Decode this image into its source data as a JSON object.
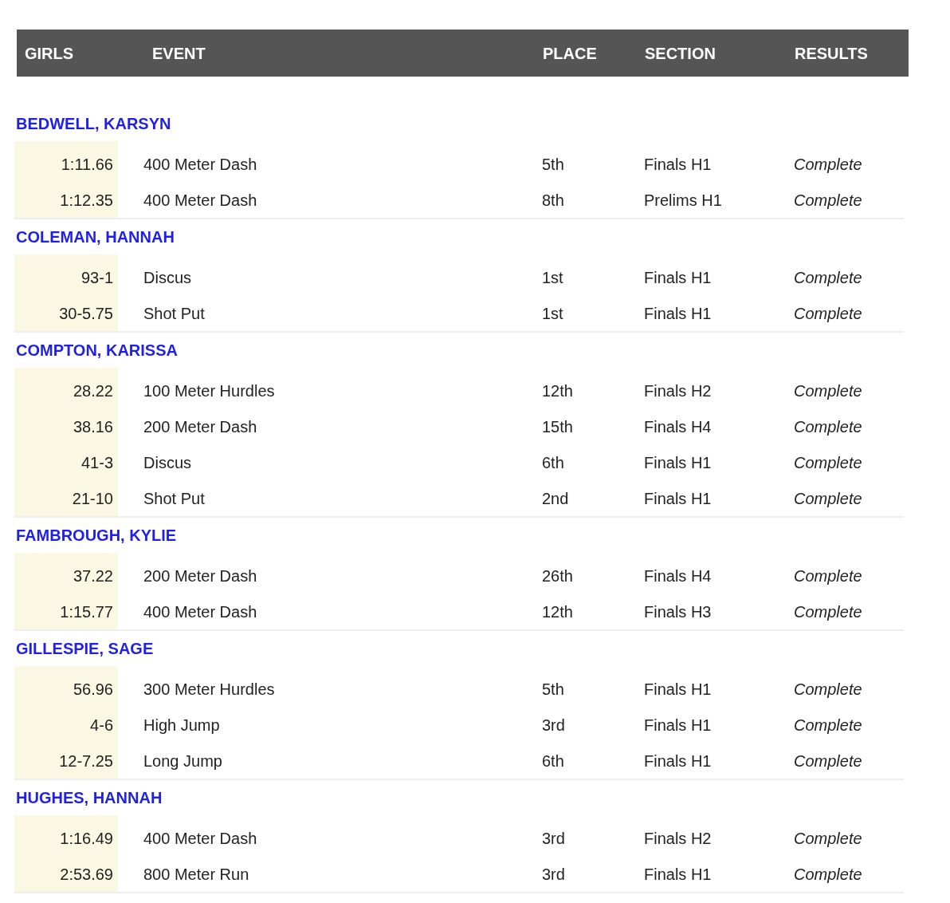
{
  "table": {
    "columns": [
      "GIRLS",
      "EVENT",
      "PLACE",
      "SECTION",
      "RESULTS"
    ],
    "athletes": [
      {
        "name": "BEDWELL, KARSYN",
        "rows": [
          {
            "mark": "1:11.66",
            "event": "400 Meter Dash",
            "place": "5th",
            "section": "Finals H1",
            "result": "Complete"
          },
          {
            "mark": "1:12.35",
            "event": "400 Meter Dash",
            "place": "8th",
            "section": "Prelims H1",
            "result": "Complete"
          }
        ]
      },
      {
        "name": "COLEMAN, HANNAH",
        "rows": [
          {
            "mark": "93-1",
            "event": "Discus",
            "place": "1st",
            "section": "Finals H1",
            "result": "Complete"
          },
          {
            "mark": "30-5.75",
            "event": "Shot Put",
            "place": "1st",
            "section": "Finals H1",
            "result": "Complete"
          }
        ]
      },
      {
        "name": "COMPTON, KARISSA",
        "rows": [
          {
            "mark": "28.22",
            "event": "100 Meter Hurdles",
            "place": "12th",
            "section": "Finals H2",
            "result": "Complete"
          },
          {
            "mark": "38.16",
            "event": "200 Meter Dash",
            "place": "15th",
            "section": "Finals H4",
            "result": "Complete"
          },
          {
            "mark": "41-3",
            "event": "Discus",
            "place": "6th",
            "section": "Finals H1",
            "result": "Complete"
          },
          {
            "mark": "21-10",
            "event": "Shot Put",
            "place": "2nd",
            "section": "Finals H1",
            "result": "Complete"
          }
        ]
      },
      {
        "name": "FAMBROUGH, KYLIE",
        "rows": [
          {
            "mark": "37.22",
            "event": "200 Meter Dash",
            "place": "26th",
            "section": "Finals H4",
            "result": "Complete"
          },
          {
            "mark": "1:15.77",
            "event": "400 Meter Dash",
            "place": "12th",
            "section": "Finals H3",
            "result": "Complete"
          }
        ]
      },
      {
        "name": "GILLESPIE, SAGE",
        "rows": [
          {
            "mark": "56.96",
            "event": "300 Meter Hurdles",
            "place": "5th",
            "section": "Finals H1",
            "result": "Complete"
          },
          {
            "mark": "4-6",
            "event": "High Jump",
            "place": "3rd",
            "section": "Finals H1",
            "result": "Complete"
          },
          {
            "mark": "12-7.25",
            "event": "Long Jump",
            "place": "6th",
            "section": "Finals H1",
            "result": "Complete"
          }
        ]
      },
      {
        "name": "HUGHES, HANNAH",
        "rows": [
          {
            "mark": "1:16.49",
            "event": "400 Meter Dash",
            "place": "3rd",
            "section": "Finals H2",
            "result": "Complete"
          },
          {
            "mark": "2:53.69",
            "event": "800 Meter Run",
            "place": "3rd",
            "section": "Finals H1",
            "result": "Complete"
          }
        ]
      }
    ]
  }
}
